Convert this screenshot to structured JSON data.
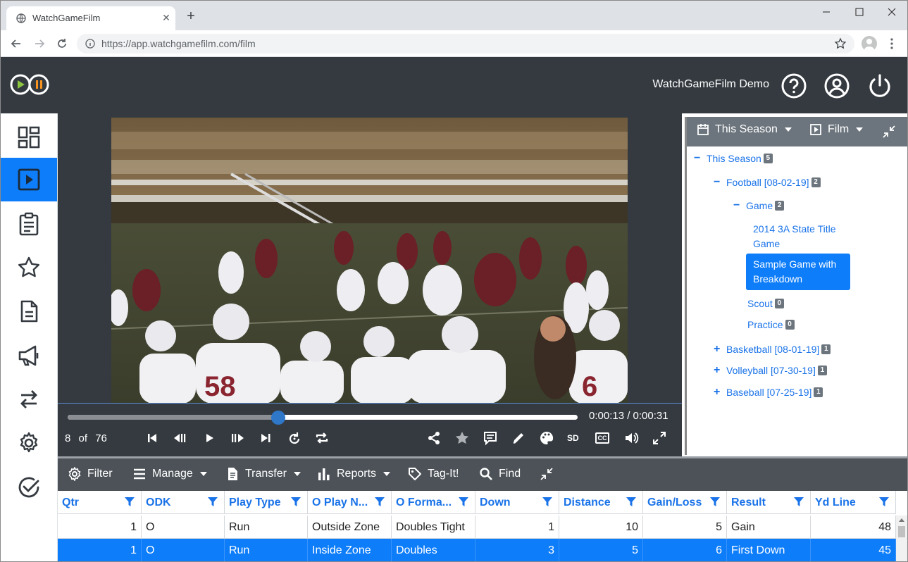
{
  "browser": {
    "tab_title": "WatchGameFilm",
    "url": "https://app.watchgamefilm.com/film"
  },
  "header": {
    "user_name": "WatchGameFilm Demo"
  },
  "colors": {
    "accent": "#0d7dfa",
    "header_bg": "#343a40",
    "toolbar_bg": "#4c5258",
    "link": "#1a73e8"
  },
  "sidebar": {
    "items": [
      {
        "icon": "dashboard-icon",
        "active": false
      },
      {
        "icon": "play-square-icon",
        "active": true
      },
      {
        "icon": "clipboard-icon",
        "active": false
      },
      {
        "icon": "star-icon",
        "active": false
      },
      {
        "icon": "document-icon",
        "active": false
      },
      {
        "icon": "megaphone-icon",
        "active": false
      },
      {
        "icon": "transfer-icon",
        "active": false
      },
      {
        "icon": "gear-icon",
        "active": false
      },
      {
        "icon": "check-circle-icon",
        "active": false
      }
    ]
  },
  "player": {
    "time": "0:00:13 / 0:00:31",
    "clip_index": "8",
    "clip_of": "of",
    "clip_total": "76",
    "progress": 0.413,
    "quality_label": "SD",
    "cc_label": "CC"
  },
  "tree": {
    "season_label": "This Season",
    "film_label": "Film",
    "root": {
      "label": "This Season",
      "count": "5"
    },
    "football": {
      "label": "Football [08-02-19]",
      "count": "2"
    },
    "game": {
      "label": "Game",
      "count": "2"
    },
    "game_items": [
      "2014 3A State Title Game",
      "Sample Game with Breakdown"
    ],
    "scout": {
      "label": "Scout",
      "count": "0"
    },
    "practice": {
      "label": "Practice",
      "count": "0"
    },
    "others": [
      {
        "label": "Basketball [08-01-19]",
        "count": "1"
      },
      {
        "label": "Volleyball [07-30-19]",
        "count": "1"
      },
      {
        "label": "Baseball [07-25-19]",
        "count": "1"
      }
    ]
  },
  "toolbar": {
    "filter": "Filter",
    "manage": "Manage",
    "transfer": "Transfer",
    "reports": "Reports",
    "tagit": "Tag-It!",
    "find": "Find"
  },
  "table": {
    "columns": [
      "Qtr",
      "ODK",
      "Play Type",
      "O Play N...",
      "O Forma...",
      "Down",
      "Distance",
      "Gain/Loss",
      "Result",
      "Yd Line"
    ],
    "rows": [
      [
        "1",
        "O",
        "Run",
        "Outside Zone",
        "Doubles Tight",
        "1",
        "10",
        "5",
        "Gain",
        "48"
      ],
      [
        "1",
        "O",
        "Run",
        "Inside Zone",
        "Doubles",
        "3",
        "5",
        "6",
        "First Down",
        "45"
      ]
    ],
    "selected_row": 1
  }
}
